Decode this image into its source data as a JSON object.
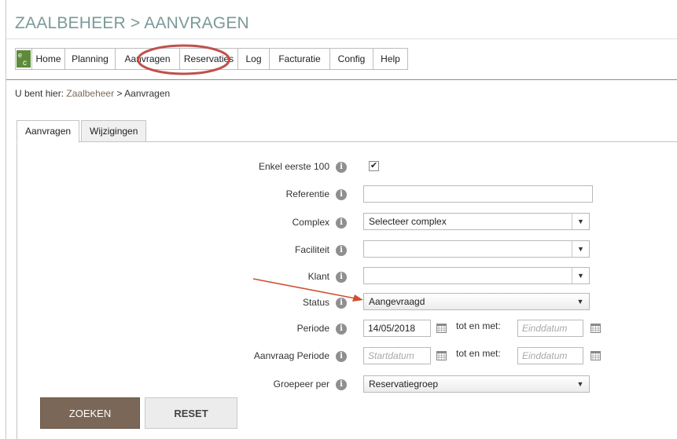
{
  "page": {
    "title": "ZAALBEHEER > AANVRAGEN"
  },
  "nav": {
    "items": [
      {
        "label": "Home"
      },
      {
        "label": "Planning"
      },
      {
        "label": "Aanvragen"
      },
      {
        "label": "Reservaties"
      },
      {
        "label": "Log"
      },
      {
        "label": "Facturatie"
      },
      {
        "label": "Config"
      },
      {
        "label": "Help"
      }
    ]
  },
  "breadcrumb": {
    "prefix": "U bent hier:",
    "link": "Zaalbeheer",
    "separator": ">",
    "current": "Aanvragen"
  },
  "tabs": [
    {
      "label": "Aanvragen",
      "active": true
    },
    {
      "label": "Wijzigingen",
      "active": false
    }
  ],
  "form": {
    "enkel_eerste": {
      "label": "Enkel eerste 100",
      "checked": true,
      "check_glyph": "✔"
    },
    "referentie": {
      "label": "Referentie",
      "value": ""
    },
    "complex": {
      "label": "Complex",
      "selected": "Selecteer complex"
    },
    "faciliteit": {
      "label": "Faciliteit",
      "selected": ""
    },
    "klant": {
      "label": "Klant",
      "selected": ""
    },
    "status": {
      "label": "Status",
      "selected": "Aangevraagd"
    },
    "periode": {
      "label": "Periode",
      "start": "14/05/2018",
      "tot_en_met": "tot en met:",
      "end_placeholder": "Einddatum"
    },
    "aanvraag_periode": {
      "label": "Aanvraag Periode",
      "start_placeholder": "Startdatum",
      "tot_en_met": "tot en met:",
      "end_placeholder": "Einddatum"
    },
    "groepeer": {
      "label": "Groepeer per",
      "selected": "Reservatiegroep"
    }
  },
  "buttons": {
    "search": "ZOEKEN",
    "reset": "RESET"
  },
  "icons": {
    "info": "i",
    "dropdown": "▼"
  },
  "colors": {
    "title": "#7a9a98",
    "search_button": "#7b6757",
    "highlight_ring": "#c0504d",
    "annotation_arrow": "#d0502e"
  }
}
